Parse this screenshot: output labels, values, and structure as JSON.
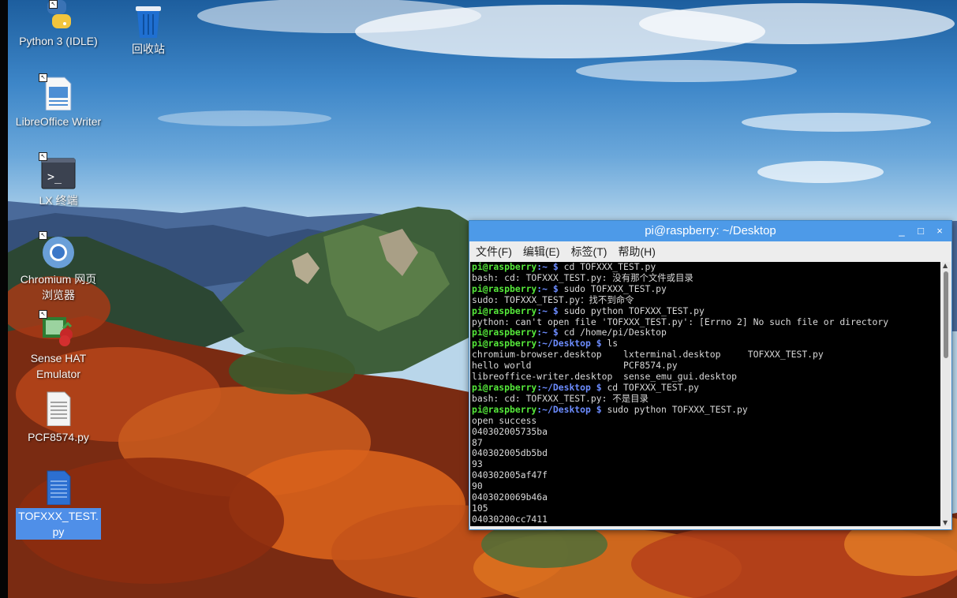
{
  "desktop": {
    "icons": [
      {
        "label": "Python 3 (IDLE)"
      },
      {
        "label": "回收站"
      },
      {
        "label": "LibreOffice Writer"
      },
      {
        "label": "LX 终端"
      },
      {
        "label": "Chromium 网页浏览器"
      },
      {
        "label": "Sense HAT Emulator"
      },
      {
        "label": "PCF8574.py"
      },
      {
        "label": "TOFXXX_TEST.py"
      }
    ]
  },
  "terminal": {
    "title": "pi@raspberry: ~/Desktop",
    "buttons": {
      "minimize": "_",
      "maximize": "□",
      "close": "×"
    },
    "menu": [
      "文件(F)",
      "编辑(E)",
      "标签(T)",
      "帮助(H)"
    ],
    "lines": [
      {
        "user": "pi@raspberry",
        "path": ":~ $",
        "cmd": " cd TOFXXX_TEST.py"
      },
      {
        "text": "bash: cd: TOFXXX_TEST.py: 没有那个文件或目录"
      },
      {
        "user": "pi@raspberry",
        "path": ":~ $",
        "cmd": " sudo TOFXXX_TEST.py"
      },
      {
        "text": "sudo: TOFXXX_TEST.py：找不到命令"
      },
      {
        "user": "pi@raspberry",
        "path": ":~ $",
        "cmd": " sudo python TOFXXX_TEST.py"
      },
      {
        "text": "python: can't open file 'TOFXXX_TEST.py': [Errno 2] No such file or directory"
      },
      {
        "user": "pi@raspberry",
        "path": ":~ $",
        "cmd": " cd /home/pi/Desktop"
      },
      {
        "user": "pi@raspberry",
        "path": ":~/Desktop $",
        "cmd": " ls"
      },
      {
        "text": "chromium-browser.desktop    lxterminal.desktop     TOFXXX_TEST.py"
      },
      {
        "text": "hello world                 PCF8574.py"
      },
      {
        "text": "libreoffice-writer.desktop  sense_emu_gui.desktop"
      },
      {
        "user": "pi@raspberry",
        "path": ":~/Desktop $",
        "cmd": " cd TOFXXX_TEST.py"
      },
      {
        "text": "bash: cd: TOFXXX_TEST.py: 不是目录"
      },
      {
        "user": "pi@raspberry",
        "path": ":~/Desktop $",
        "cmd": " sudo python TOFXXX_TEST.py"
      },
      {
        "text": "open success"
      },
      {
        "text": "040302005735ba"
      },
      {
        "text": "87"
      },
      {
        "text": "040302005db5bd"
      },
      {
        "text": "93"
      },
      {
        "text": "040302005af47f"
      },
      {
        "text": "90"
      },
      {
        "text": "0403020069b46a"
      },
      {
        "text": "105"
      },
      {
        "text": "04030200cc7411"
      }
    ]
  }
}
